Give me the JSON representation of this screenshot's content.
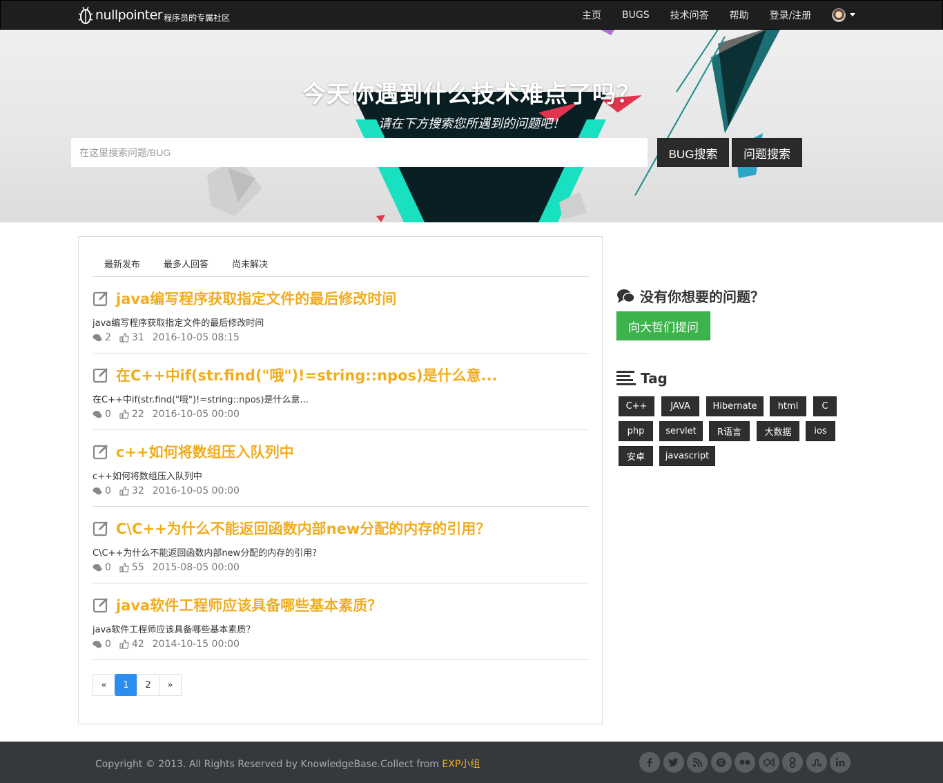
{
  "navbar": {
    "brand": "nullpointer",
    "tagline": "程序员的专属社区",
    "links": [
      "主页",
      "BUGS",
      "技术问答",
      "帮助",
      "登录/注册"
    ]
  },
  "hero": {
    "title": "今天你遇到什么技术难点了吗？",
    "subtitle": "请在下方搜索您所遇到的问题吧！",
    "search_placeholder": "在这里搜索问题/BUG",
    "btn_bug": "BUG搜索",
    "btn_question": "问题搜索"
  },
  "tabs": [
    "最新发布",
    "最多人回答",
    "尚未解决"
  ],
  "posts": [
    {
      "title": "java编写程序获取指定文件的最后修改时间",
      "desc": "java编写程序获取指定文件的最后修改时间",
      "comments": "2",
      "likes": "31",
      "date": "2016-10-05 08:15"
    },
    {
      "title": "在C++中if(str.find(\"哦\")!=string::npos)是什么意...",
      "desc": "在C++中if(str.find(\"哦\")!=string::npos)是什么意...",
      "comments": "0",
      "likes": "22",
      "date": "2016-10-05 00:00"
    },
    {
      "title": "c++如何将数组压入队列中",
      "desc": "c++如何将数组压入队列中",
      "comments": "0",
      "likes": "32",
      "date": "2016-10-05 00:00"
    },
    {
      "title": "C\\C++为什么不能返回函数内部new分配的内存的引用？",
      "desc": "C\\C++为什么不能返回函数内部new分配的内存的引用？",
      "comments": "0",
      "likes": "55",
      "date": "2015-08-05 00:00"
    },
    {
      "title": "java软件工程师应该具备哪些基本素质？",
      "desc": "java软件工程师应该具备哪些基本素质？",
      "comments": "0",
      "likes": "42",
      "date": "2014-10-15 00:00"
    }
  ],
  "pagination": [
    "«",
    "1",
    "2",
    "»"
  ],
  "sidebar": {
    "ask_heading": "没有你想要的问题？",
    "ask_button": "向大哲们提问",
    "tag_heading": "Tag",
    "tags": [
      "C++",
      "JAVA",
      "Hibernate",
      "html",
      "C",
      "php",
      "servlet",
      "R语言",
      "大数据",
      "ios",
      "安卓",
      "javascript"
    ]
  },
  "footer": {
    "copyright": "Copyright © 2013. All Rights Reserved by KnowledgeBase.Collect from ",
    "group": "EXP小组",
    "social": [
      "facebook-icon",
      "twitter-icon",
      "rss-icon",
      "skype-icon",
      "flickr-icon",
      "vimeo-icon",
      "google-plus-icon",
      "stumbleupon-icon",
      "linkedin-icon"
    ]
  },
  "colors": {
    "accent": "#f0ad1e",
    "primary": "#2d8cf0",
    "success": "#3cb44b",
    "navbar": "#1e1e1e",
    "footer": "#35393d"
  }
}
